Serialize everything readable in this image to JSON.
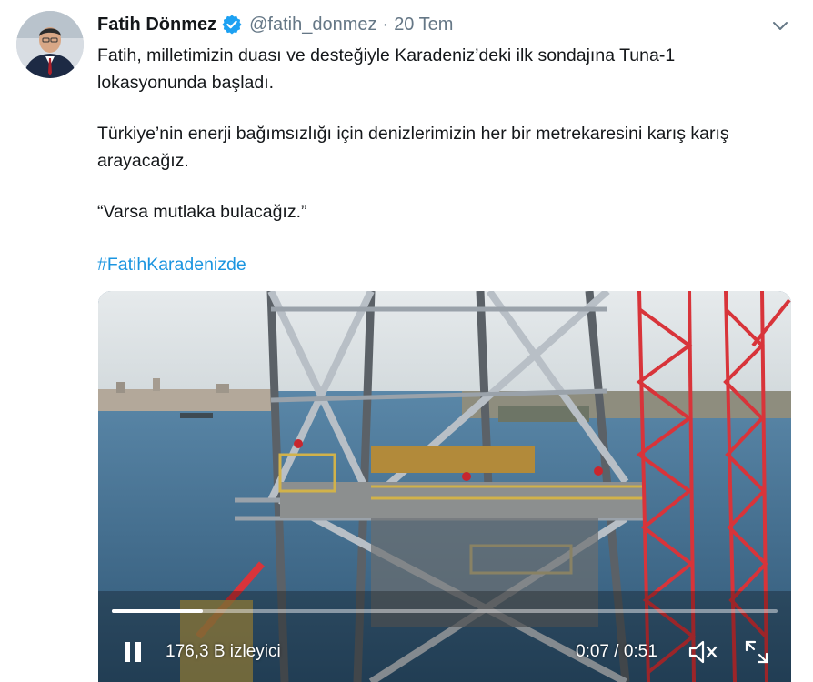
{
  "tweet": {
    "author_name": "Fatih Dönmez",
    "handle": "@fatih_donmez",
    "separator": "·",
    "date": "20 Tem",
    "verified": true,
    "paragraphs": [
      "Fatih, milletimizin duası ve desteğiyle Karadeniz’deki ilk sondajına Tuna-1 lokasyonunda başladı.",
      "Türkiye’nin enerji bağımsızlığı için denizlerimizin her bir metrekaresini karış karış arayacağız.",
      "“Varsa mutlaka bulacağız.”"
    ],
    "hashtag": "#FatihKaradenizde"
  },
  "video": {
    "views": "176,3 B izleyici",
    "time_current": "0:07",
    "time_separator": "/",
    "time_total": "0:51",
    "progress_fraction": 0.137
  },
  "colors": {
    "link": "#1b95e0",
    "verified": "#1da1f2",
    "secondary_text": "#657786"
  },
  "icons": [
    "avatar",
    "verified-badge-icon",
    "chevron-down-icon",
    "pause-icon",
    "volume-muted-icon",
    "fullscreen-icon"
  ]
}
